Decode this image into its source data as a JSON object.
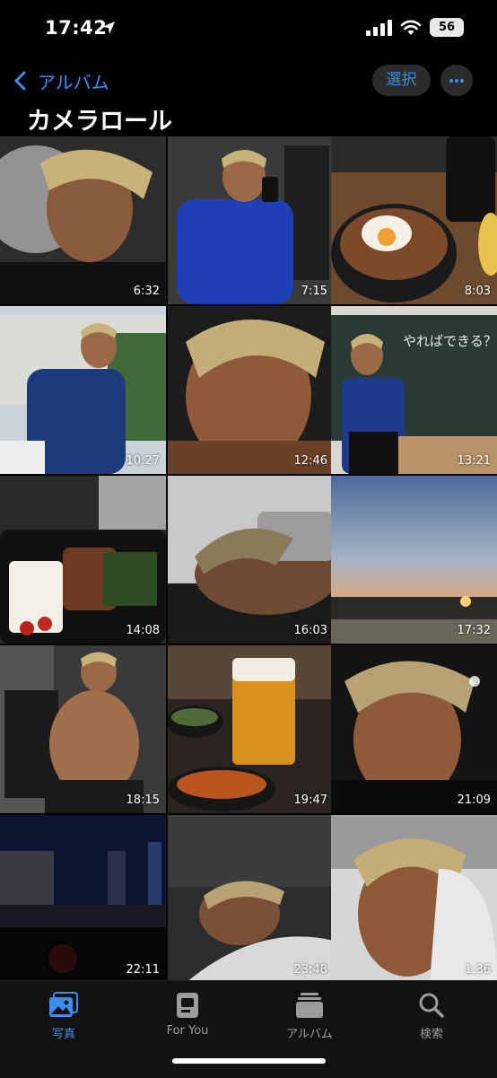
{
  "status_bar": {
    "time": "17:42",
    "battery": "56"
  },
  "nav": {
    "back_label": "アルバム",
    "select_label": "選択",
    "title": "カメラロール"
  },
  "grid": {
    "items": [
      {
        "duration": "6:32"
      },
      {
        "duration": "7:15"
      },
      {
        "duration": "8:03"
      },
      {
        "duration": "10:27"
      },
      {
        "duration": "12:46"
      },
      {
        "duration": "13:21"
      },
      {
        "duration": "14:08"
      },
      {
        "duration": "16:03"
      },
      {
        "duration": "17:32"
      },
      {
        "duration": "18:15"
      },
      {
        "duration": "19:47"
      },
      {
        "duration": "21:09"
      },
      {
        "duration": "22:11"
      },
      {
        "duration": "23:48"
      },
      {
        "duration": "1:36"
      }
    ],
    "blackboard_text": "やればできる？"
  },
  "tabs": [
    {
      "label": "写真",
      "icon": "photos-icon",
      "active": true
    },
    {
      "label": "For You",
      "icon": "for-you-icon",
      "active": false
    },
    {
      "label": "アルバム",
      "icon": "albums-icon",
      "active": false
    },
    {
      "label": "検索",
      "icon": "search-icon",
      "active": false
    }
  ],
  "colors": {
    "accent": "#3b8ef0",
    "background": "#000000",
    "tabbar": "#121212"
  }
}
